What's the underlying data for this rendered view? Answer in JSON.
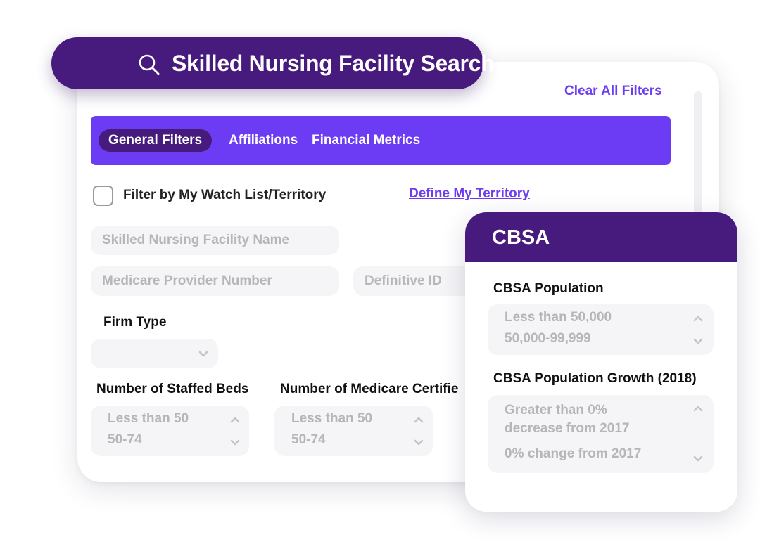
{
  "search": {
    "title": "Skilled Nursing Facility Search",
    "icon": "search-icon"
  },
  "header": {
    "clear_filters": "Clear All Filters"
  },
  "tabs": [
    {
      "label": "General Filters",
      "active": true
    },
    {
      "label": "Affiliations",
      "active": false
    },
    {
      "label": "Financial Metrics",
      "active": false
    }
  ],
  "watchlist": {
    "label": "Filter by My Watch List/Territory",
    "checked": false,
    "define_link": "Define My Territory"
  },
  "inputs": {
    "facility_name_placeholder": "Skilled Nursing Facility Name",
    "medicare_provider_placeholder": "Medicare Provider Number",
    "definitive_id_placeholder": "Definitive ID"
  },
  "firm_type": {
    "label": "Firm Type",
    "value": ""
  },
  "staffed_beds": {
    "label": "Number of Staffed Beds",
    "options": [
      "Less than 50",
      "50-74"
    ]
  },
  "medicare_certified": {
    "label": "Number of Medicare Certifie",
    "options": [
      "Less than 50",
      "50-74"
    ]
  },
  "cbsa": {
    "title": "CBSA",
    "population": {
      "label": "CBSA Population",
      "options": [
        "Less than 50,000",
        "50,000-99,999"
      ]
    },
    "growth": {
      "label": "CBSA Population Growth (2018)",
      "options": [
        "Greater than 0%",
        "decrease from 2017",
        "0% change from 2017"
      ]
    }
  },
  "colors": {
    "brand_dark": "#471a7d",
    "brand_accent": "#6c3cf5",
    "link": "#6b3cf0",
    "field_bg": "#f5f5f7",
    "placeholder": "#b6b6b6"
  }
}
